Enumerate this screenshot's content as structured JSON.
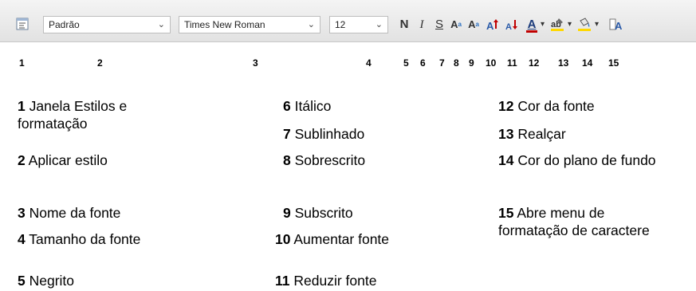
{
  "toolbar": {
    "style_value": "Padrão",
    "font_name_value": "Times New Roman",
    "font_size_value": "12",
    "buttons": {
      "bold": "N",
      "italic": "I",
      "underline": "S",
      "superscript": "A",
      "subscript": "A",
      "font_color_letter": "A",
      "font_color": "#c00000",
      "highlight_color": "#ffd800",
      "background_color": "#ffd800"
    }
  },
  "callout_numbers": [
    "1",
    "2",
    "3",
    "4",
    "5",
    "6",
    "7",
    "8",
    "9",
    "10",
    "11",
    "12",
    "13",
    "14",
    "15"
  ],
  "legend": [
    {
      "n": "1",
      "text": "Janela Estilos e formatação"
    },
    {
      "n": "2",
      "text": "Aplicar estilo"
    },
    {
      "n": "3",
      "text": "Nome da fonte"
    },
    {
      "n": "4",
      "text": "Tamanho da fonte"
    },
    {
      "n": "5",
      "text": "Negrito"
    },
    {
      "n": "6",
      "text": "Itálico"
    },
    {
      "n": "7",
      "text": "Sublinhado"
    },
    {
      "n": "8",
      "text": "Sobrescrito"
    },
    {
      "n": "9",
      "text": "Subscrito"
    },
    {
      "n": "10",
      "text": "Aumentar fonte"
    },
    {
      "n": "11",
      "text": "Reduzir fonte"
    },
    {
      "n": "12",
      "text": "Cor da fonte"
    },
    {
      "n": "13",
      "text": "Realçar"
    },
    {
      "n": "14",
      "text": "Cor do plano de fundo"
    },
    {
      "n": "15",
      "text": "Abre menu de formatação de caractere"
    }
  ]
}
